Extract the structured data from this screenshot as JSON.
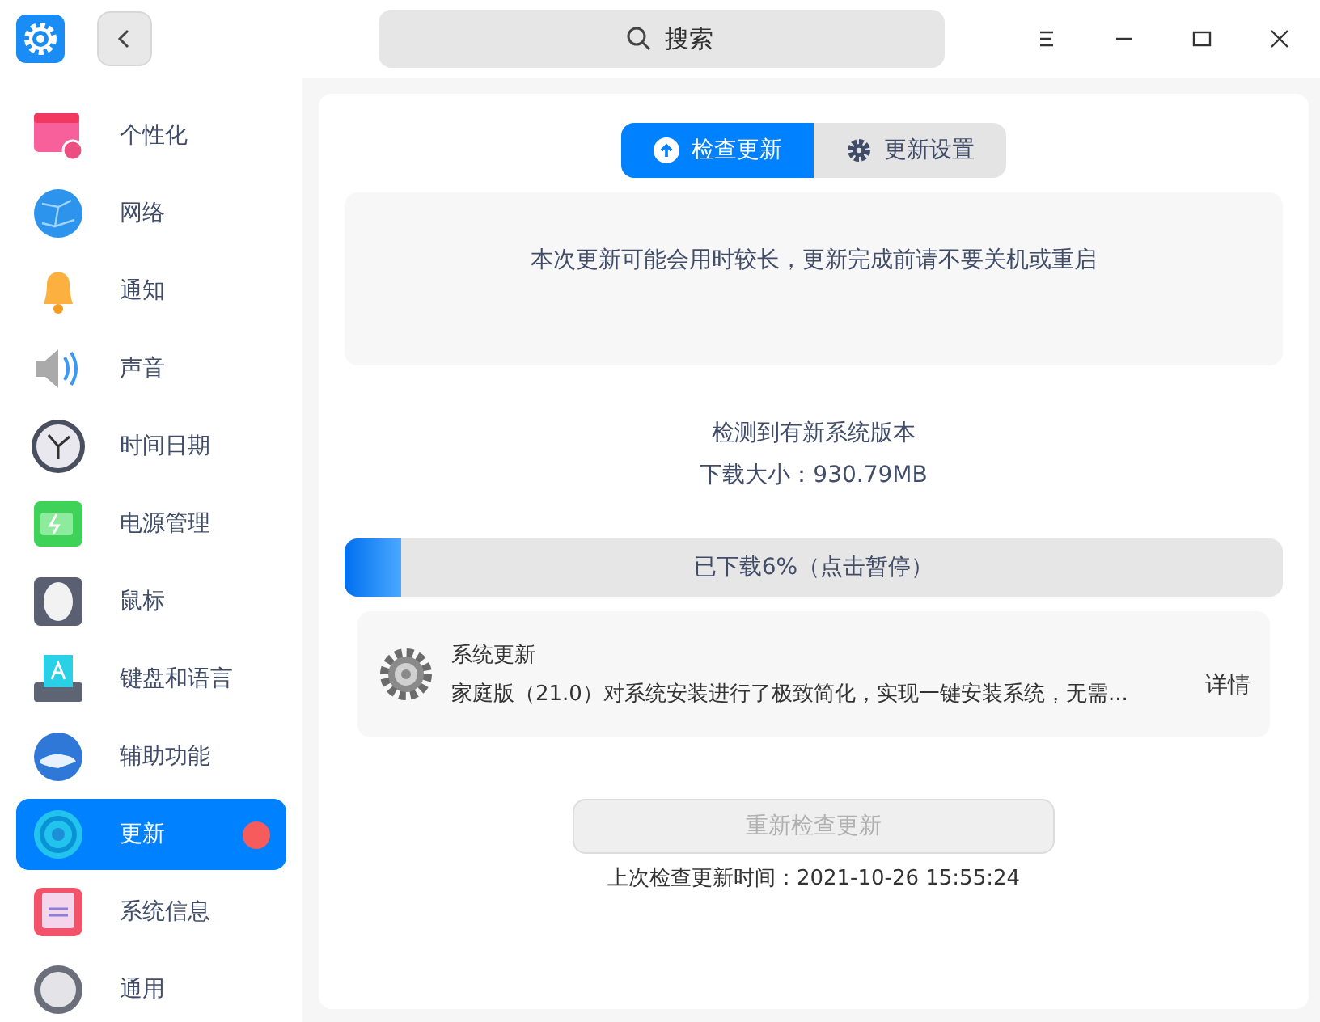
{
  "titlebar": {
    "search_placeholder": "搜索"
  },
  "sidebar": {
    "items": [
      {
        "label": "个性化",
        "selected": false,
        "badge": false
      },
      {
        "label": "网络",
        "selected": false,
        "badge": false
      },
      {
        "label": "通知",
        "selected": false,
        "badge": false
      },
      {
        "label": "声音",
        "selected": false,
        "badge": false
      },
      {
        "label": "时间日期",
        "selected": false,
        "badge": false
      },
      {
        "label": "电源管理",
        "selected": false,
        "badge": false
      },
      {
        "label": "鼠标",
        "selected": false,
        "badge": false
      },
      {
        "label": "键盘和语言",
        "selected": false,
        "badge": false
      },
      {
        "label": "辅助功能",
        "selected": false,
        "badge": false
      },
      {
        "label": "更新",
        "selected": true,
        "badge": true
      },
      {
        "label": "系统信息",
        "selected": false,
        "badge": false
      },
      {
        "label": "通用",
        "selected": false,
        "badge": false
      }
    ]
  },
  "tabs": [
    {
      "label": "检查更新",
      "selected": true
    },
    {
      "label": "更新设置",
      "selected": false
    }
  ],
  "notice": "本次更新可能会用时较长，更新完成前请不要关机或重启",
  "status": "检测到有新系统版本",
  "download_size": "下载大小：930.79MB",
  "progress": {
    "label": "已下载6%（点击暂停）",
    "level": 0.06
  },
  "update_item": {
    "title": "系统更新",
    "description": "家庭版（21.0）对系统安装进行了极致简化，实现一键安装系统，无需...",
    "details": "详情"
  },
  "recheck_button": {
    "label": "重新检查更新",
    "disabled": true
  },
  "last_check": "上次检查更新时间：2021-10-26 15:55:24"
}
